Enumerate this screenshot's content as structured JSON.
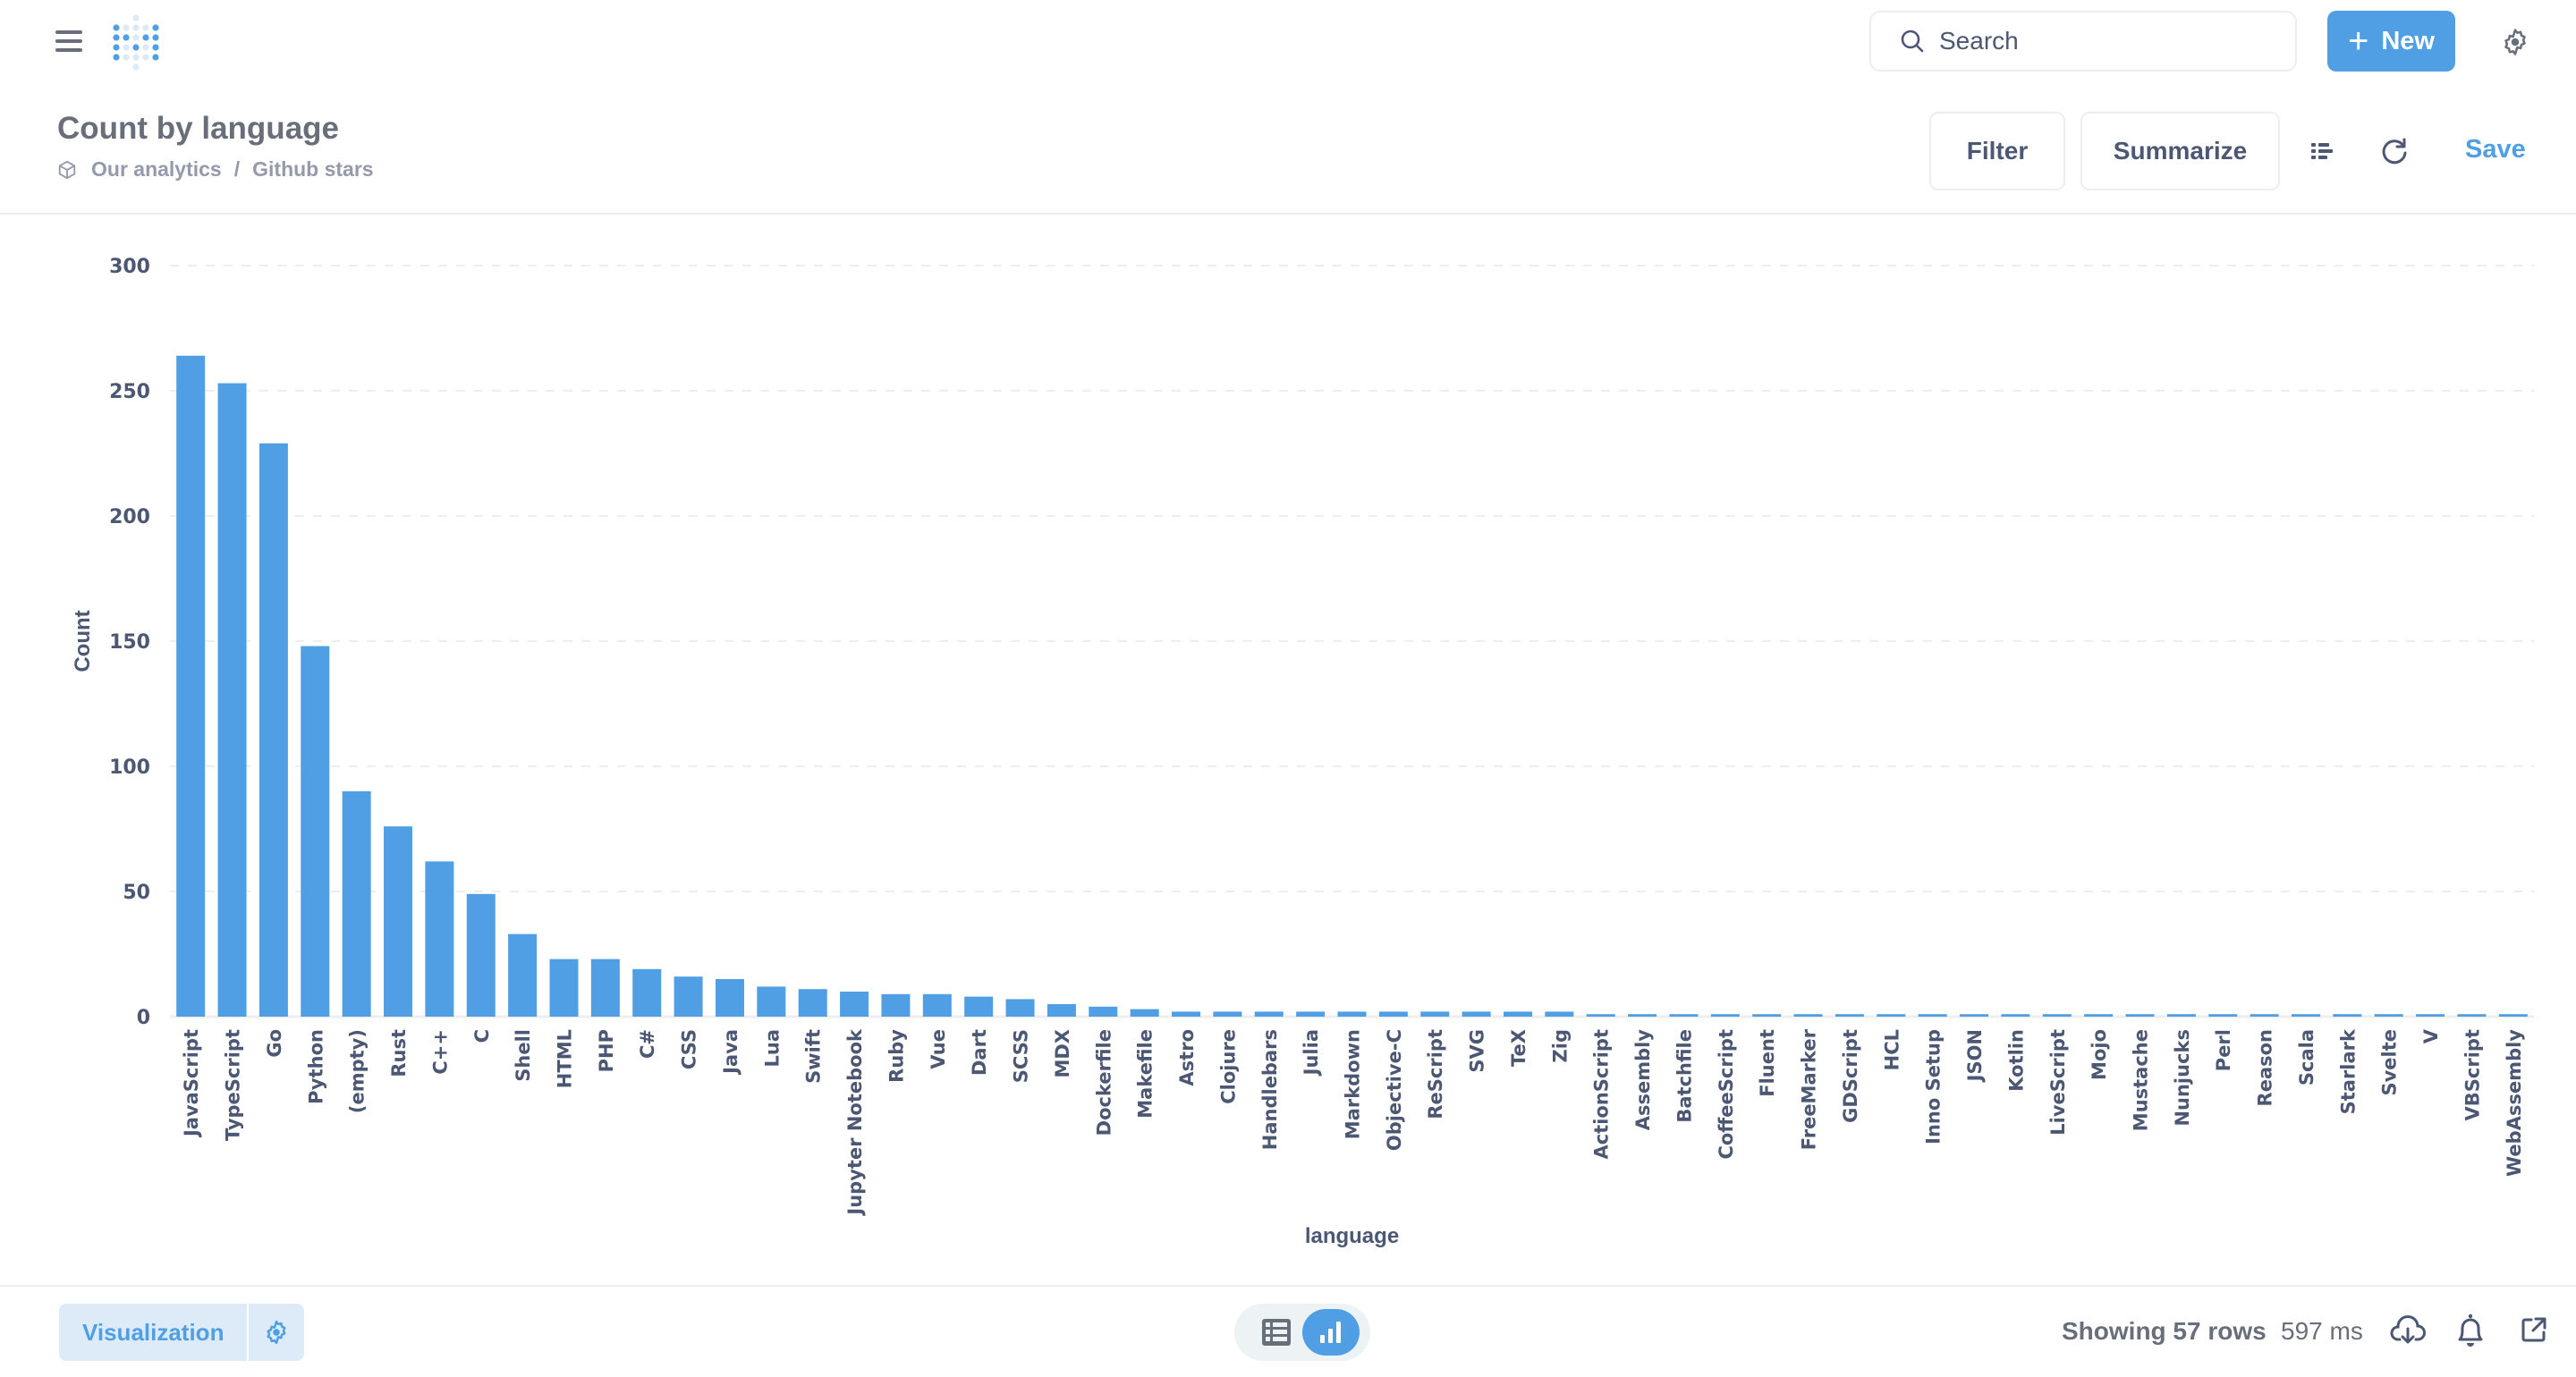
{
  "topbar": {
    "search_placeholder": "Search",
    "new_label": "New"
  },
  "header": {
    "title": "Count by language",
    "breadcrumb": [
      "Our analytics",
      "Github stars"
    ],
    "breadcrumb_separator": "/",
    "filter_label": "Filter",
    "summarize_label": "Summarize",
    "save_label": "Save"
  },
  "colors": {
    "accent": "#509ee3",
    "bar": "#509ee3",
    "text": "#4c5773",
    "muted": "#949aab",
    "grid": "#eeeeef"
  },
  "icons": {
    "menu": "hamburger-icon",
    "logo": "metabase-logo",
    "search": "search-icon",
    "new": "plus-icon",
    "settings": "gear-icon",
    "collection": "cube-icon",
    "editor": "notebook-list-icon",
    "refresh": "refresh-icon",
    "table": "table-icon",
    "chart": "bar-chart-icon",
    "download": "cloud-download-icon",
    "alert": "bell-icon",
    "share": "share-icon"
  },
  "footer": {
    "visualization_label": "Visualization",
    "rows_text": "Showing 57 rows",
    "time_text": "597 ms",
    "active_view": "chart"
  },
  "chart_data": {
    "type": "bar",
    "title": "Count by language",
    "xlabel": "language",
    "ylabel": "Count",
    "ylim": [
      0,
      300
    ],
    "yticks": [
      0,
      50,
      100,
      150,
      200,
      250,
      300
    ],
    "grid": true,
    "legend": "none",
    "categories": [
      "JavaScript",
      "TypeScript",
      "Go",
      "Python",
      "(empty)",
      "Rust",
      "C++",
      "C",
      "Shell",
      "HTML",
      "PHP",
      "C#",
      "CSS",
      "Java",
      "Lua",
      "Swift",
      "Jupyter Notebook",
      "Ruby",
      "Vue",
      "Dart",
      "SCSS",
      "MDX",
      "Dockerfile",
      "Makefile",
      "Astro",
      "Clojure",
      "Handlebars",
      "Julia",
      "Markdown",
      "Objective-C",
      "ReScript",
      "SVG",
      "TeX",
      "Zig",
      "ActionScript",
      "Assembly",
      "Batchfile",
      "CoffeeScript",
      "Fluent",
      "FreeMarker",
      "GDScript",
      "HCL",
      "Inno Setup",
      "JSON",
      "Kotlin",
      "LiveScript",
      "Mojo",
      "Mustache",
      "Nunjucks",
      "Perl",
      "Reason",
      "Scala",
      "Starlark",
      "Svelte",
      "V",
      "VBScript",
      "WebAssembly"
    ],
    "values": [
      264,
      253,
      229,
      148,
      90,
      76,
      62,
      49,
      33,
      23,
      23,
      19,
      16,
      15,
      12,
      11,
      10,
      9,
      9,
      8,
      7,
      5,
      4,
      3,
      2,
      2,
      2,
      2,
      2,
      2,
      2,
      2,
      2,
      2,
      1,
      1,
      1,
      1,
      1,
      1,
      1,
      1,
      1,
      1,
      1,
      1,
      1,
      1,
      1,
      1,
      1,
      1,
      1,
      1,
      1,
      1,
      1
    ]
  }
}
